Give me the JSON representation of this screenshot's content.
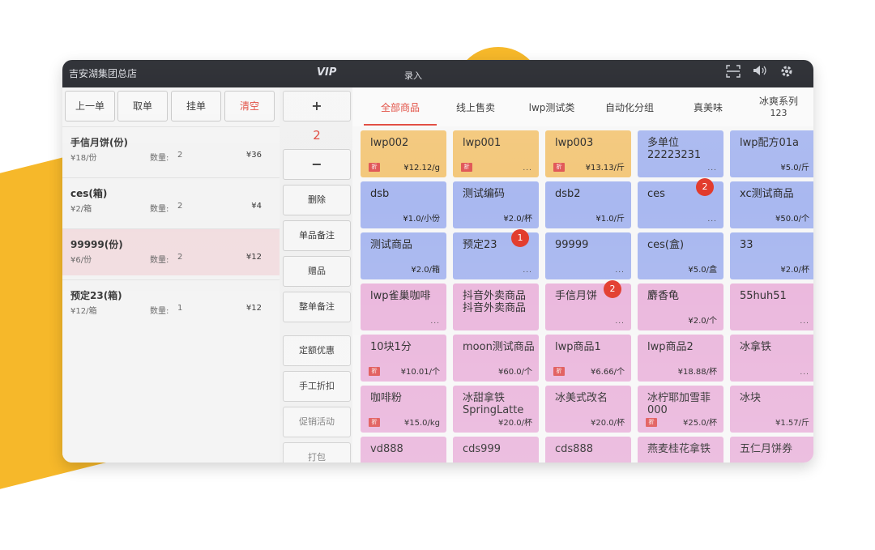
{
  "topbar": {
    "store_name": "吉安湖集团总店",
    "vip_label": "VIP",
    "entry_label": "录入",
    "scan_icon": "scan-icon",
    "broadcast_icon": "broadcast-icon",
    "settings_icon": "gear-icon"
  },
  "left": {
    "buttons": {
      "prev": "上一单",
      "fetch": "取单",
      "hold": "挂单",
      "clear": "清空"
    },
    "orders": [
      {
        "name": "手信月饼(份)",
        "price": "¥18/份",
        "qty_label": "数量:",
        "qty": "2",
        "total": "¥36",
        "selected": false
      },
      {
        "name": "ces(箱)",
        "price": "¥2/箱",
        "qty_label": "数量:",
        "qty": "2",
        "total": "¥4",
        "selected": false
      },
      {
        "name": "99999(份)",
        "price": "¥6/份",
        "qty_label": "数量:",
        "qty": "2",
        "total": "¥12",
        "selected": true
      },
      {
        "name": "预定23(箱)",
        "price": "¥12/箱",
        "qty_label": "数量:",
        "qty": "1",
        "total": "¥12",
        "selected": false
      }
    ]
  },
  "mid": {
    "plus": "+",
    "qty": "2",
    "minus": "−",
    "delete": "删除",
    "item_note": "单品备注",
    "gift": "赠品",
    "order_note": "整单备注",
    "fixed_discount": "定额优惠",
    "manual_discount": "手工折扣",
    "promotion": "促销活动",
    "takeaway": "打包"
  },
  "tabs": [
    {
      "label": "全部商品",
      "sub": ""
    },
    {
      "label": "线上售卖",
      "sub": ""
    },
    {
      "label": "lwp测试类",
      "sub": ""
    },
    {
      "label": "自动化分组",
      "sub": ""
    },
    {
      "label": "真美味",
      "sub": ""
    },
    {
      "label": "冰爽系列",
      "sub": "123"
    }
  ],
  "colors": {
    "accent": "#e0463a",
    "tile_orange": "#f3c77a",
    "tile_blue": "#a9b8f0",
    "tile_pink": "#eab6dc",
    "background_blob": "#f6b82a"
  },
  "products": [
    {
      "name": "lwp002",
      "price": "¥12.12/g",
      "tag": "折",
      "count": "",
      "color": "orange"
    },
    {
      "name": "lwp001",
      "price": "...",
      "tag": "折",
      "count": "",
      "color": "orange"
    },
    {
      "name": "lwp003",
      "price": "¥13.13/斤",
      "tag": "折",
      "count": "",
      "color": "orange"
    },
    {
      "name": "多单位 22223231",
      "price": "...",
      "tag": "",
      "count": "",
      "color": "blue"
    },
    {
      "name": "lwp配方01a",
      "price": "¥5.0/斤",
      "tag": "",
      "count": "",
      "color": "blue"
    },
    {
      "name": "dsb",
      "price": "¥1.0/小份",
      "tag": "",
      "count": "",
      "color": "blue"
    },
    {
      "name": "测试编码",
      "price": "¥2.0/杯",
      "tag": "",
      "count": "",
      "color": "blue"
    },
    {
      "name": "dsb2",
      "price": "¥1.0/斤",
      "tag": "",
      "count": "",
      "color": "blue"
    },
    {
      "name": "ces",
      "price": "...",
      "tag": "",
      "count": "2",
      "color": "blue"
    },
    {
      "name": "xc测试商品",
      "price": "¥50.0/个",
      "tag": "",
      "count": "",
      "color": "blue"
    },
    {
      "name": "测试商品",
      "price": "¥2.0/箱",
      "tag": "",
      "count": "",
      "color": "blue"
    },
    {
      "name": "预定23",
      "price": "...",
      "tag": "",
      "count": "1",
      "color": "blue"
    },
    {
      "name": "99999",
      "price": "...",
      "tag": "",
      "count": "",
      "color": "blue"
    },
    {
      "name": "ces(盒)",
      "price": "¥5.0/盒",
      "tag": "",
      "count": "",
      "color": "blue"
    },
    {
      "name": "33",
      "price": "¥2.0/杯",
      "tag": "",
      "count": "",
      "color": "blue"
    },
    {
      "name": "lwp雀巢咖啡",
      "price": "...",
      "tag": "",
      "count": "",
      "color": "pink"
    },
    {
      "name": "抖音外卖商品 抖音外卖商品",
      "price": "",
      "tag": "",
      "count": "",
      "color": "pink"
    },
    {
      "name": "手信月饼",
      "price": "...",
      "tag": "",
      "count": "2",
      "color": "pink"
    },
    {
      "name": "麝香龟",
      "price": "¥2.0/个",
      "tag": "",
      "count": "",
      "color": "pink"
    },
    {
      "name": "55huh51",
      "price": "...",
      "tag": "",
      "count": "",
      "color": "pink"
    },
    {
      "name": "10块1分",
      "price": "¥10.01/个",
      "tag": "折",
      "count": "",
      "color": "pink"
    },
    {
      "name": "moon测试商品",
      "price": "¥60.0/个",
      "tag": "",
      "count": "",
      "color": "pink"
    },
    {
      "name": "lwp商品1",
      "price": "¥6.66/个",
      "tag": "折",
      "count": "",
      "color": "pink"
    },
    {
      "name": "lwp商品2",
      "price": "¥18.88/杯",
      "tag": "",
      "count": "",
      "color": "pink"
    },
    {
      "name": "冰拿铁",
      "price": "...",
      "tag": "",
      "count": "",
      "color": "pink"
    },
    {
      "name": "咖啡粉",
      "price": "¥15.0/kg",
      "tag": "折",
      "count": "",
      "color": "pink"
    },
    {
      "name": "冰甜拿铁 SpringLatte",
      "price": "¥20.0/杯",
      "tag": "",
      "count": "",
      "color": "pink"
    },
    {
      "name": "冰美式改名",
      "price": "¥20.0/杯",
      "tag": "",
      "count": "",
      "color": "pink"
    },
    {
      "name": "冰柠耶加雪菲 000",
      "price": "¥25.0/杯",
      "tag": "折",
      "count": "",
      "color": "pink"
    },
    {
      "name": "冰块",
      "price": "¥1.57/斤",
      "tag": "",
      "count": "",
      "color": "pink"
    },
    {
      "name": "vd888",
      "price": "",
      "tag": "",
      "count": "",
      "color": "pink"
    },
    {
      "name": "cds999",
      "price": "",
      "tag": "",
      "count": "",
      "color": "pink"
    },
    {
      "name": "cds888",
      "price": "",
      "tag": "",
      "count": "",
      "color": "pink"
    },
    {
      "name": "燕麦桂花拿铁",
      "price": "",
      "tag": "",
      "count": "",
      "color": "pink"
    },
    {
      "name": "五仁月饼券",
      "price": "",
      "tag": "",
      "count": "",
      "color": "pink"
    }
  ]
}
